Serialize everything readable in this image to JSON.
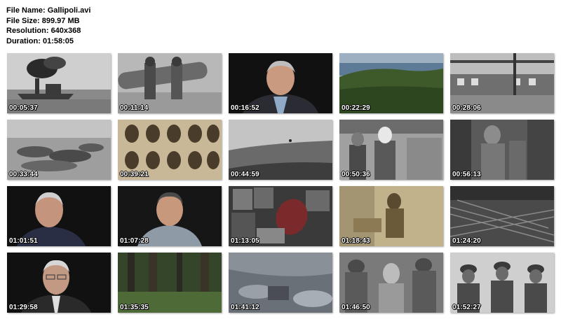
{
  "file_info": {
    "name_label": "File Name:",
    "name": "Gallipoli.avi",
    "size_label": "File Size:",
    "size": "899.97 MB",
    "resolution_label": "Resolution:",
    "resolution": "640x368",
    "duration_label": "Duration:",
    "duration": "01:58:05"
  },
  "thumbnails": [
    {
      "time": "00:05:37",
      "scene": "battleship-smoke"
    },
    {
      "time": "00:11:14",
      "scene": "soldiers-cannon"
    },
    {
      "time": "00:16:52",
      "scene": "interview-man"
    },
    {
      "time": "00:22:29",
      "scene": "aerial-coast"
    },
    {
      "time": "00:28:06",
      "scene": "ship-deck"
    },
    {
      "time": "00:33:44",
      "scene": "fallen-soldiers"
    },
    {
      "time": "00:39:21",
      "scene": "portrait-grid"
    },
    {
      "time": "00:44:59",
      "scene": "hill-landscape"
    },
    {
      "time": "00:50:36",
      "scene": "wounded-soldier"
    },
    {
      "time": "00:56:13",
      "scene": "trench-soldier"
    },
    {
      "time": "01:01:51",
      "scene": "interview-old-man"
    },
    {
      "time": "01:07:28",
      "scene": "interview-man-shirt"
    },
    {
      "time": "01:13:05",
      "scene": "food-tins"
    },
    {
      "time": "01:18:43",
      "scene": "soldier-desk"
    },
    {
      "time": "01:24:20",
      "scene": "barbed-wire"
    },
    {
      "time": "01:29:58",
      "scene": "interview-glasses"
    },
    {
      "time": "01:35:35",
      "scene": "forest"
    },
    {
      "time": "01:41:12",
      "scene": "trench-sandbags"
    },
    {
      "time": "01:46:50",
      "scene": "officer-group"
    },
    {
      "time": "01:52:27",
      "scene": "three-soldiers"
    }
  ],
  "colors": {
    "background": "#ffffff",
    "timestamp": "#ffffff"
  }
}
